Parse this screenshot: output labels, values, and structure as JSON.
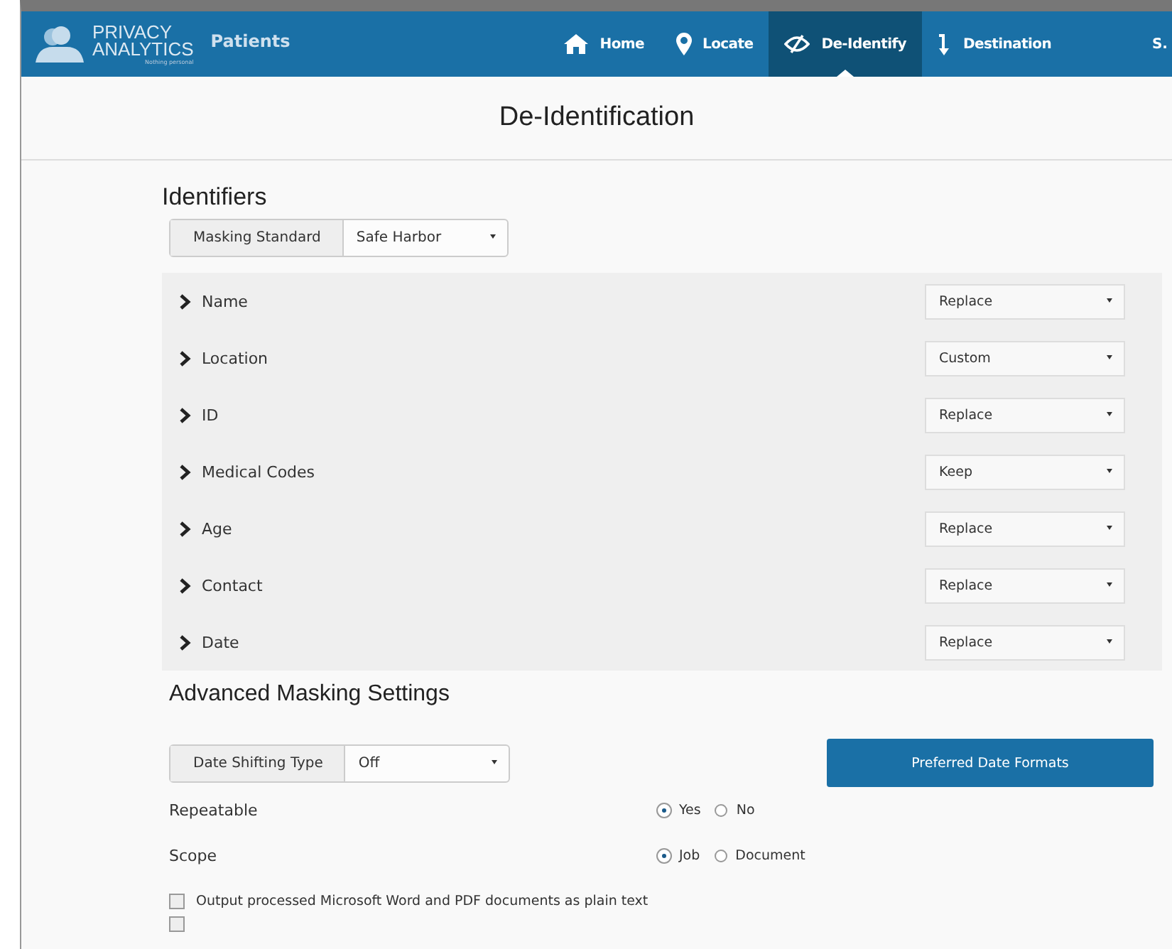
{
  "brand": {
    "name_line1": "PRIVACY",
    "name_line2": "ANALYTICS",
    "tagline": "Nothing personal"
  },
  "app_title": "Patients",
  "nav": [
    {
      "label": "Home",
      "selected": false
    },
    {
      "label": "Locate",
      "selected": false
    },
    {
      "label": "De-Identify",
      "selected": true
    },
    {
      "label": "Destination",
      "selected": false
    }
  ],
  "user": "S.",
  "page_title": "De-Identification",
  "identifiers": {
    "heading": "Identifiers",
    "masking_standard": {
      "label": "Masking Standard",
      "value": "Safe Harbor"
    },
    "rows": [
      {
        "name": "Name",
        "action": "Replace",
        "expanded": false
      },
      {
        "name": "Location",
        "action": "Custom",
        "expanded": false
      },
      {
        "name": "ID",
        "action": "Replace",
        "expanded": false
      },
      {
        "name": "Medical Codes",
        "action": "Keep",
        "expanded": false
      },
      {
        "name": "Age",
        "action": "Replace",
        "expanded": false
      },
      {
        "name": "Contact",
        "action": "Replace",
        "expanded": false
      },
      {
        "name": "Date",
        "action": "Replace",
        "expanded": false
      }
    ]
  },
  "advanced": {
    "heading": "Advanced Masking Settings",
    "date_shifting": {
      "label": "Date Shifting Type",
      "value": "Off"
    },
    "preferred_button": "Preferred Date Formats",
    "radio_groups": [
      {
        "label": "Repeatable",
        "options": [
          {
            "label": "Yes",
            "selected": true
          },
          {
            "label": "No",
            "selected": false
          }
        ]
      },
      {
        "label": "Scope",
        "options": [
          {
            "label": "Job",
            "selected": true
          },
          {
            "label": "Document",
            "selected": false
          }
        ]
      }
    ],
    "checkboxes": [
      {
        "label": "Output processed Microsoft Word and PDF documents as plain text",
        "checked": false
      },
      {
        "checked": false
      }
    ]
  }
}
